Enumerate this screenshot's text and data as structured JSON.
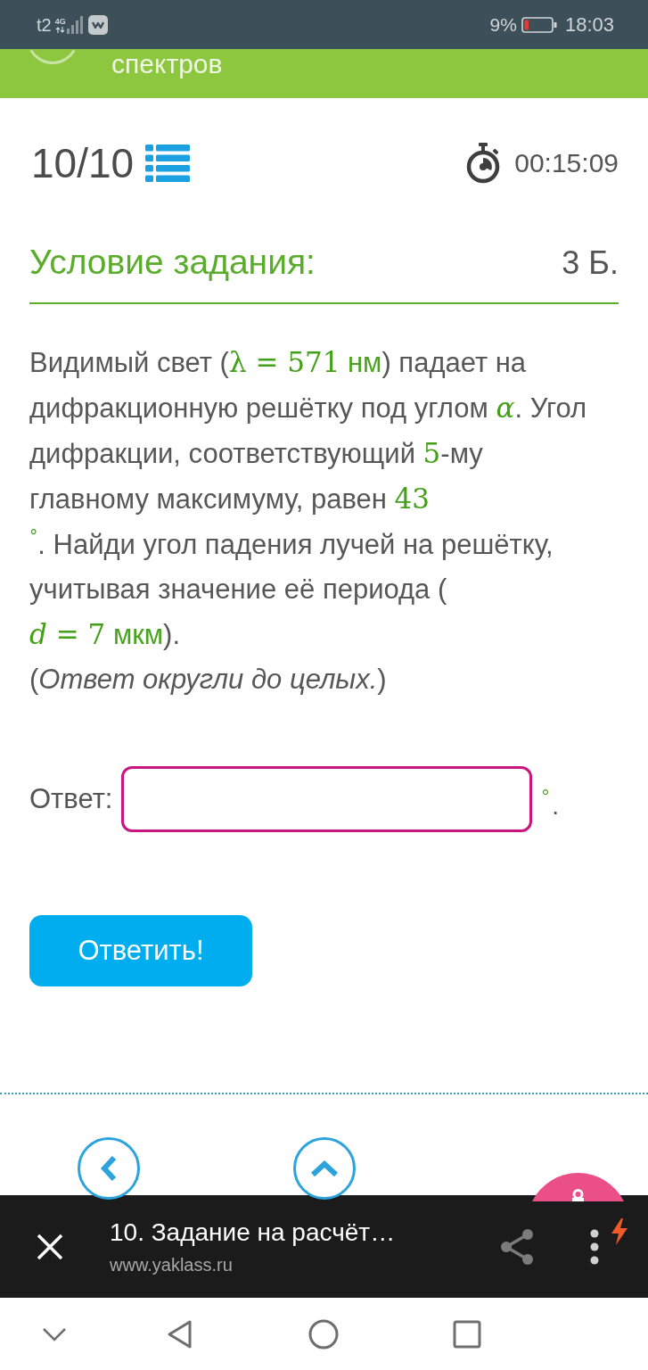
{
  "status_bar": {
    "carrier": "t2",
    "network": "4G",
    "battery": "9%",
    "time": "18:03"
  },
  "header_strip": {
    "title": "спектров"
  },
  "progress": {
    "counter": "10/10",
    "timer": "00:15:09"
  },
  "task": {
    "heading": "Условие задания:",
    "points": "3 Б.",
    "text": [
      {
        "kind": "text",
        "text": "Видимый свет ("
      },
      {
        "kind": "math",
        "text": "λ = 571"
      },
      {
        "kind": "unit",
        "text": " нм"
      },
      {
        "kind": "text",
        "text": ") падает на\nдифракционную решётку под углом "
      },
      {
        "kind": "math",
        "text": "*α*"
      },
      {
        "kind": "text",
        "text": ". Угол\nдифракции, соответствующий "
      },
      {
        "kind": "math",
        "text": "5"
      },
      {
        "kind": "text",
        "text": "-му\nглавному максимуму, равен "
      },
      {
        "kind": "math",
        "text": "43"
      },
      {
        "kind": "break"
      },
      {
        "kind": "math",
        "text": "$^{°}$"
      },
      {
        "kind": "text",
        "text": ". Найди угол падения лучей на решётку,\nучитывая значение её периода (\n"
      },
      {
        "kind": "math",
        "text": "*d* = 7"
      },
      {
        "kind": "unit",
        "text": " мкм"
      },
      {
        "kind": "text",
        "text": ")."
      }
    ],
    "note": "(*Ответ округли до целых.*)"
  },
  "answer": {
    "label": "Ответ:",
    "unit": "$^{°}$",
    "suffix": ".",
    "submit": "Ответить!"
  },
  "browser_bar": {
    "title": "10. Задание на расчёт…",
    "url": "www.yaklass.ru"
  }
}
